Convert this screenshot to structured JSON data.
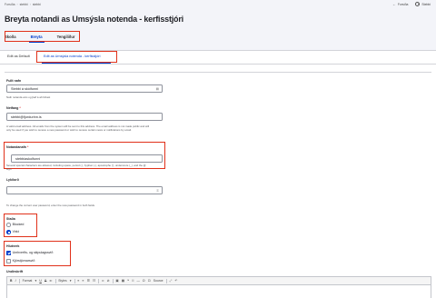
{
  "breadcrumb": [
    "Forsíða",
    "stebbi",
    "stebbi"
  ],
  "top_right": {
    "back_label": "Forsíða",
    "user_label": "Stebbi"
  },
  "page_title": "Breyta notandi as Umsýsla notenda - kerfisstjóri",
  "tabs": [
    {
      "label": "Skoða"
    },
    {
      "label": "Breyta"
    },
    {
      "label": "Tengiliður"
    }
  ],
  "subtabs": [
    {
      "label": "Edit as Default"
    },
    {
      "label": "Edit as Umsýsla notenda - kerfisstjóri"
    }
  ],
  "full_name": {
    "label": "Fullt nafn",
    "value": "Stebbi á skólfunni",
    "help": "Nafn notanda eins og það á að birtast"
  },
  "email": {
    "label": "Netfang",
    "value": "stebbi@fjordurinn.is",
    "help": "A valid email address. All emails from the system will be sent to this address. The email address is not made public and will only be used if you wish to receive a new password or wish to receive certain news or notifications by email."
  },
  "username": {
    "label": "Notandanafn",
    "value": "stebbiaskolfunni",
    "help": "Several special characters are allowed, including space, period (.), hyphen (-), apostrophe ('), underscore (_), and the @ sign."
  },
  "password": {
    "label": "Lykilorð",
    "value": "",
    "help": "To change the current user password, enter the new password in both fields."
  },
  "status": {
    "label": "Staða",
    "options": [
      {
        "label": "Blocked",
        "checked": false
      },
      {
        "label": "Virkt",
        "checked": true
      }
    ]
  },
  "roles": {
    "label": "Hlutverk",
    "options": [
      {
        "label": "Umhverfis- og skipulagssvið",
        "checked": true
      },
      {
        "label": "Kjörstjórnarsvið",
        "checked": false
      }
    ]
  },
  "signature": {
    "label": "Undirskrift",
    "toolbar": [
      "B",
      "I",
      "Format",
      "Styles",
      "Source"
    ]
  },
  "colors": {
    "accent": "#003ecc",
    "highlight": "#e0311a",
    "header_bg": "#f3f4f9"
  }
}
